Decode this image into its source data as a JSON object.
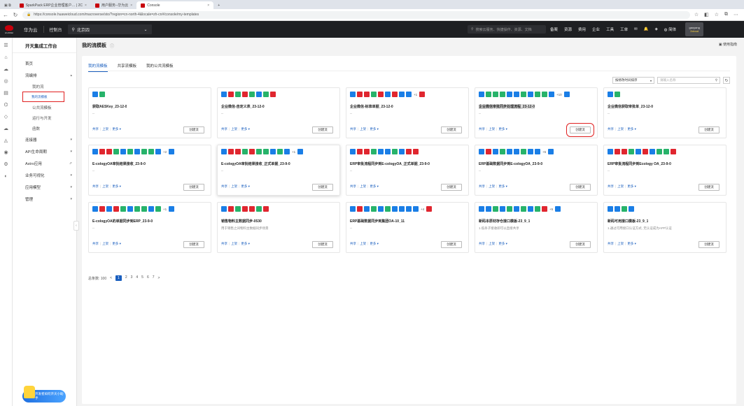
{
  "browser": {
    "tabs": [
      {
        "label": "SparkPack ERP企业管理客户… | 2C"
      },
      {
        "label": "用户服务--华为云"
      },
      {
        "label": "Console"
      }
    ],
    "url": "https://console.huaweicloud.com/macroverse/sto/?region=cn-north-4&locale=zh-cn#/console/my-templates"
  },
  "topbar": {
    "brand": "华为云",
    "console": "控制台",
    "region": "北京四",
    "search_placeholder": "搜索云服务、快捷操作、资源、文档",
    "nav": [
      "备案",
      "资源",
      "费用",
      "企业",
      "工具",
      "工单"
    ],
    "lang": "简体",
    "user_line1": "gaoyang",
    "user_line2": "2cloud"
  },
  "sidebar": {
    "title": "开天集成工作台",
    "items": [
      {
        "label": "首页",
        "arrow": ""
      },
      {
        "label": "流编排",
        "arrow": "▴"
      },
      {
        "label": "我的流",
        "arrow": "",
        "sub": true
      },
      {
        "label": "我的流模板",
        "arrow": "",
        "sub": true,
        "selected": true
      },
      {
        "label": "公共流模板",
        "arrow": "",
        "sub": true
      },
      {
        "label": "运行与开发",
        "arrow": "",
        "sub": true
      },
      {
        "label": "函数",
        "arrow": "",
        "sub": true
      },
      {
        "label": "连接器",
        "arrow": "▾"
      },
      {
        "label": "API生命周期",
        "arrow": "▾"
      },
      {
        "label": "Astro应用",
        "arrow": "⇗"
      },
      {
        "label": "业务可视化",
        "arrow": "▾"
      },
      {
        "label": "应用模型",
        "arrow": "▾"
      },
      {
        "label": "管理",
        "arrow": "▾"
      }
    ],
    "promo": "开发者如何开天小助手"
  },
  "page": {
    "title": "我的流模板",
    "guide": "使用指南",
    "tabs": [
      "我的流模板",
      "共享流模板",
      "我的公共流模板"
    ],
    "sort": "按修改时间排序",
    "search_placeholder": "请输入名称"
  },
  "card_actions": {
    "share": "共享",
    "publish": "上架",
    "more": "更多 ▾",
    "create": "创建流"
  },
  "cards": [
    {
      "name": "获取AESKey_23-12-0",
      "desc": "--",
      "icons": [
        "#1a7ee6",
        "#27b36a"
      ],
      "more": ""
    },
    {
      "name": "企业微信-自定义表_23-12-0",
      "desc": "--",
      "icons": [
        "#1a7ee6",
        "#e0262f",
        "#27b36a",
        "#e0262f",
        "#27b36a",
        "#1a7ee6",
        "#27b36a",
        "#e0262f"
      ],
      "more": ""
    },
    {
      "name": "企业微信-标准单据_23-12-0",
      "desc": "--",
      "icons": [
        "#1a7ee6",
        "#e0262f",
        "#e0262f",
        "#27b36a",
        "#e0262f",
        "#1a7ee6",
        "#e0262f",
        "#1a7ee6",
        "#1a7ee6"
      ],
      "more": "+1",
      "tail": "#e0262f"
    },
    {
      "name": "企业微信审批同步处理流程_23-12-0",
      "desc": "--",
      "icons": [
        "#1a7ee6",
        "#27b36a",
        "#27b36a",
        "#27b36a",
        "#1a7ee6",
        "#1a7ee6",
        "#27b36a",
        "#1a7ee6",
        "#27b36a",
        "#27b36a",
        "#1a7ee6"
      ],
      "more": "+10",
      "tail": "#1a7ee6",
      "highlight": true,
      "redbtn": true
    },
    {
      "name": "企业微信获取审批单_23-12-0",
      "desc": "--",
      "icons": [
        "#1a7ee6",
        "#27b36a"
      ],
      "more": ""
    },
    {
      "name": "E-cologyOA审批结果接收_23-9-0",
      "desc": "--",
      "icons": [
        "#1a7ee6",
        "#e0262f",
        "#e0262f",
        "#27b36a",
        "#1a7ee6",
        "#27b36a",
        "#1a7ee6",
        "#27b36a",
        "#27b36a",
        "#1a7ee6"
      ],
      "more": "+2",
      "tail": "#1a7ee6"
    },
    {
      "name": "E-cologyOA审批结果接收_正式单据_23-9-0",
      "desc": "--",
      "icons": [
        "#1a7ee6",
        "#e0262f",
        "#e0262f",
        "#27b36a",
        "#e0262f",
        "#27b36a",
        "#27b36a",
        "#1a7ee6",
        "#27b36a",
        "#1a7ee6"
      ],
      "more": "+1",
      "tail": "#1a7ee6",
      "hover": true
    },
    {
      "name": "ERP审批流程同步到E-cologyOA_正式单据_23-9-0",
      "desc": "--",
      "icons": [
        "#1a7ee6",
        "#e0262f",
        "#e0262f",
        "#27b36a",
        "#1a7ee6",
        "#1a7ee6",
        "#27b36a",
        "#1a7ee6",
        "#e0262f",
        "#e0262f"
      ],
      "more": ""
    },
    {
      "name": "ERP基础数据同步到E-cologyOA_23-9-0",
      "desc": "--",
      "icons": [
        "#1a7ee6",
        "#e0262f",
        "#1a7ee6",
        "#27b36a",
        "#1a7ee6",
        "#1a7ee6",
        "#27b36a",
        "#1a7ee6",
        "#1a7ee6"
      ],
      "more": "+5",
      "tail": "#1a7ee6"
    },
    {
      "name": "ERP审批流程同步到Ecology OA_23-9-0",
      "desc": "--",
      "icons": [
        "#1a7ee6",
        "#e0262f",
        "#e0262f",
        "#27b36a",
        "#1a7ee6",
        "#e0262f",
        "#1a7ee6",
        "#27b36a",
        "#27b36a",
        "#e0262f"
      ],
      "more": ""
    },
    {
      "name": "E-cologyOA的单据同步到ERP_23-9-0",
      "desc": "--",
      "icons": [
        "#1a7ee6",
        "#e0262f",
        "#1a7ee6",
        "#e0262f",
        "#27b36a",
        "#1a7ee6",
        "#27b36a",
        "#27b36a",
        "#1a7ee6",
        "#27b36a"
      ],
      "more": "+1",
      "tail": "#1a7ee6"
    },
    {
      "name": "销售物料主数据同步-0530",
      "desc": "用于销售之间物料主数据同步场景",
      "icons": [
        "#1a7ee6",
        "#e0262f",
        "#27b36a",
        "#e0262f",
        "#e0262f",
        "#27b36a",
        "#e0262f"
      ],
      "more": ""
    },
    {
      "name": "ERP基础数据同步到集团OA-10_11",
      "desc": "--",
      "icons": [
        "#1a7ee6",
        "#e0262f",
        "#1a7ee6",
        "#27b36a",
        "#1a7ee6",
        "#27b36a",
        "#1a7ee6",
        "#1a7ee6",
        "#1a7ee6",
        "#1a7ee6"
      ],
      "more": "+4",
      "tail": "#e0262f"
    },
    {
      "name": "新码本原材存仓接口模板-23_9_1",
      "desc": "1.低条子接收即可以直接共享",
      "icons": [
        "#1a7ee6",
        "#1a7ee6",
        "#27b36a",
        "#1a7ee6",
        "#27b36a",
        "#1a7ee6",
        "#27b36a",
        "#1a7ee6",
        "#27b36a",
        "#e0262f"
      ],
      "more": "+5",
      "tail": "#1a7ee6"
    },
    {
      "name": "新码可用接口模板-23_9_1",
      "desc": "1.通过可用接口认证方式, 无认证成为APP认证",
      "icons": [
        "#1a7ee6",
        "#1a7ee6",
        "#27b36a",
        "#1a7ee6"
      ],
      "more": ""
    }
  ],
  "pager": {
    "total": "总条数: 100",
    "prev": "<",
    "pages": [
      "1",
      "2",
      "3",
      "4",
      "5",
      "6",
      "7"
    ],
    "next": ">"
  }
}
